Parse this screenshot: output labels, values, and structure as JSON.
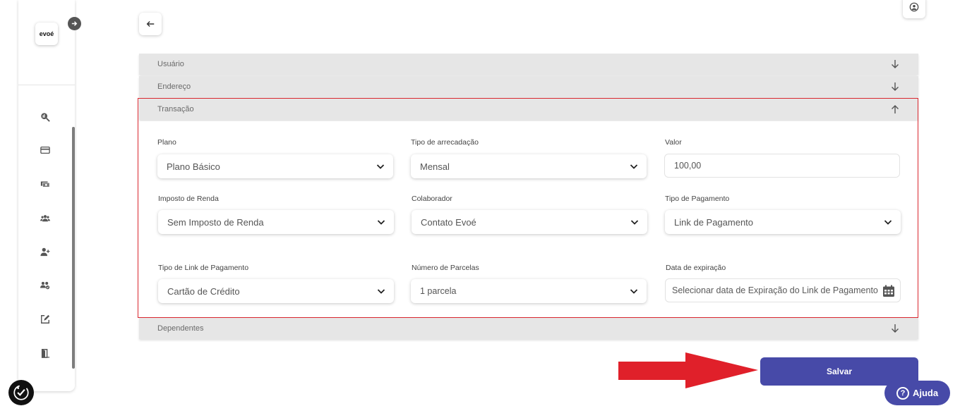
{
  "sidebar": {
    "logo_text": "evoé",
    "expand_icon": "arrow-right-circle-icon",
    "nav_icons": [
      "search-chart-icon",
      "card-icon",
      "money-icon",
      "users-icon",
      "user-add-icon",
      "users-group-icon",
      "edit-icon",
      "exit-door-icon"
    ]
  },
  "header": {
    "back_icon": "arrow-left-icon",
    "user_icon": "user-circle-icon"
  },
  "sections": {
    "usuario": "Usuário",
    "endereco": "Endereço",
    "transacao": "Transação",
    "dependentes": "Dependentes"
  },
  "form": {
    "plano": {
      "label": "Plano",
      "value": "Plano Básico"
    },
    "tipo_arrecadacao": {
      "label": "Tipo de arrecadação",
      "value": "Mensal"
    },
    "valor": {
      "label": "Valor",
      "value": "100,00"
    },
    "imposto_renda": {
      "label": "Imposto de Renda",
      "value": "Sem Imposto de Renda"
    },
    "colaborador": {
      "label": "Colaborador",
      "value": "Contato Evoé"
    },
    "tipo_pagamento": {
      "label": "Tipo de Pagamento",
      "value": "Link de Pagamento"
    },
    "tipo_link": {
      "label": "Tipo de Link de Pagamento",
      "value": "Cartão de Crédito"
    },
    "numero_parcelas": {
      "label": "Número de Parcelas",
      "value": "1 parcela"
    },
    "data_expiracao": {
      "label": "Data de expiração",
      "placeholder": "Selecionar data de Expiração do Link de Pagamento"
    }
  },
  "actions": {
    "save_label": "Salvar",
    "help_label": "Ajuda"
  },
  "colors": {
    "primary": "#474aa8",
    "annotation_red": "#e0202a",
    "section_header": "#e6e6e6"
  }
}
